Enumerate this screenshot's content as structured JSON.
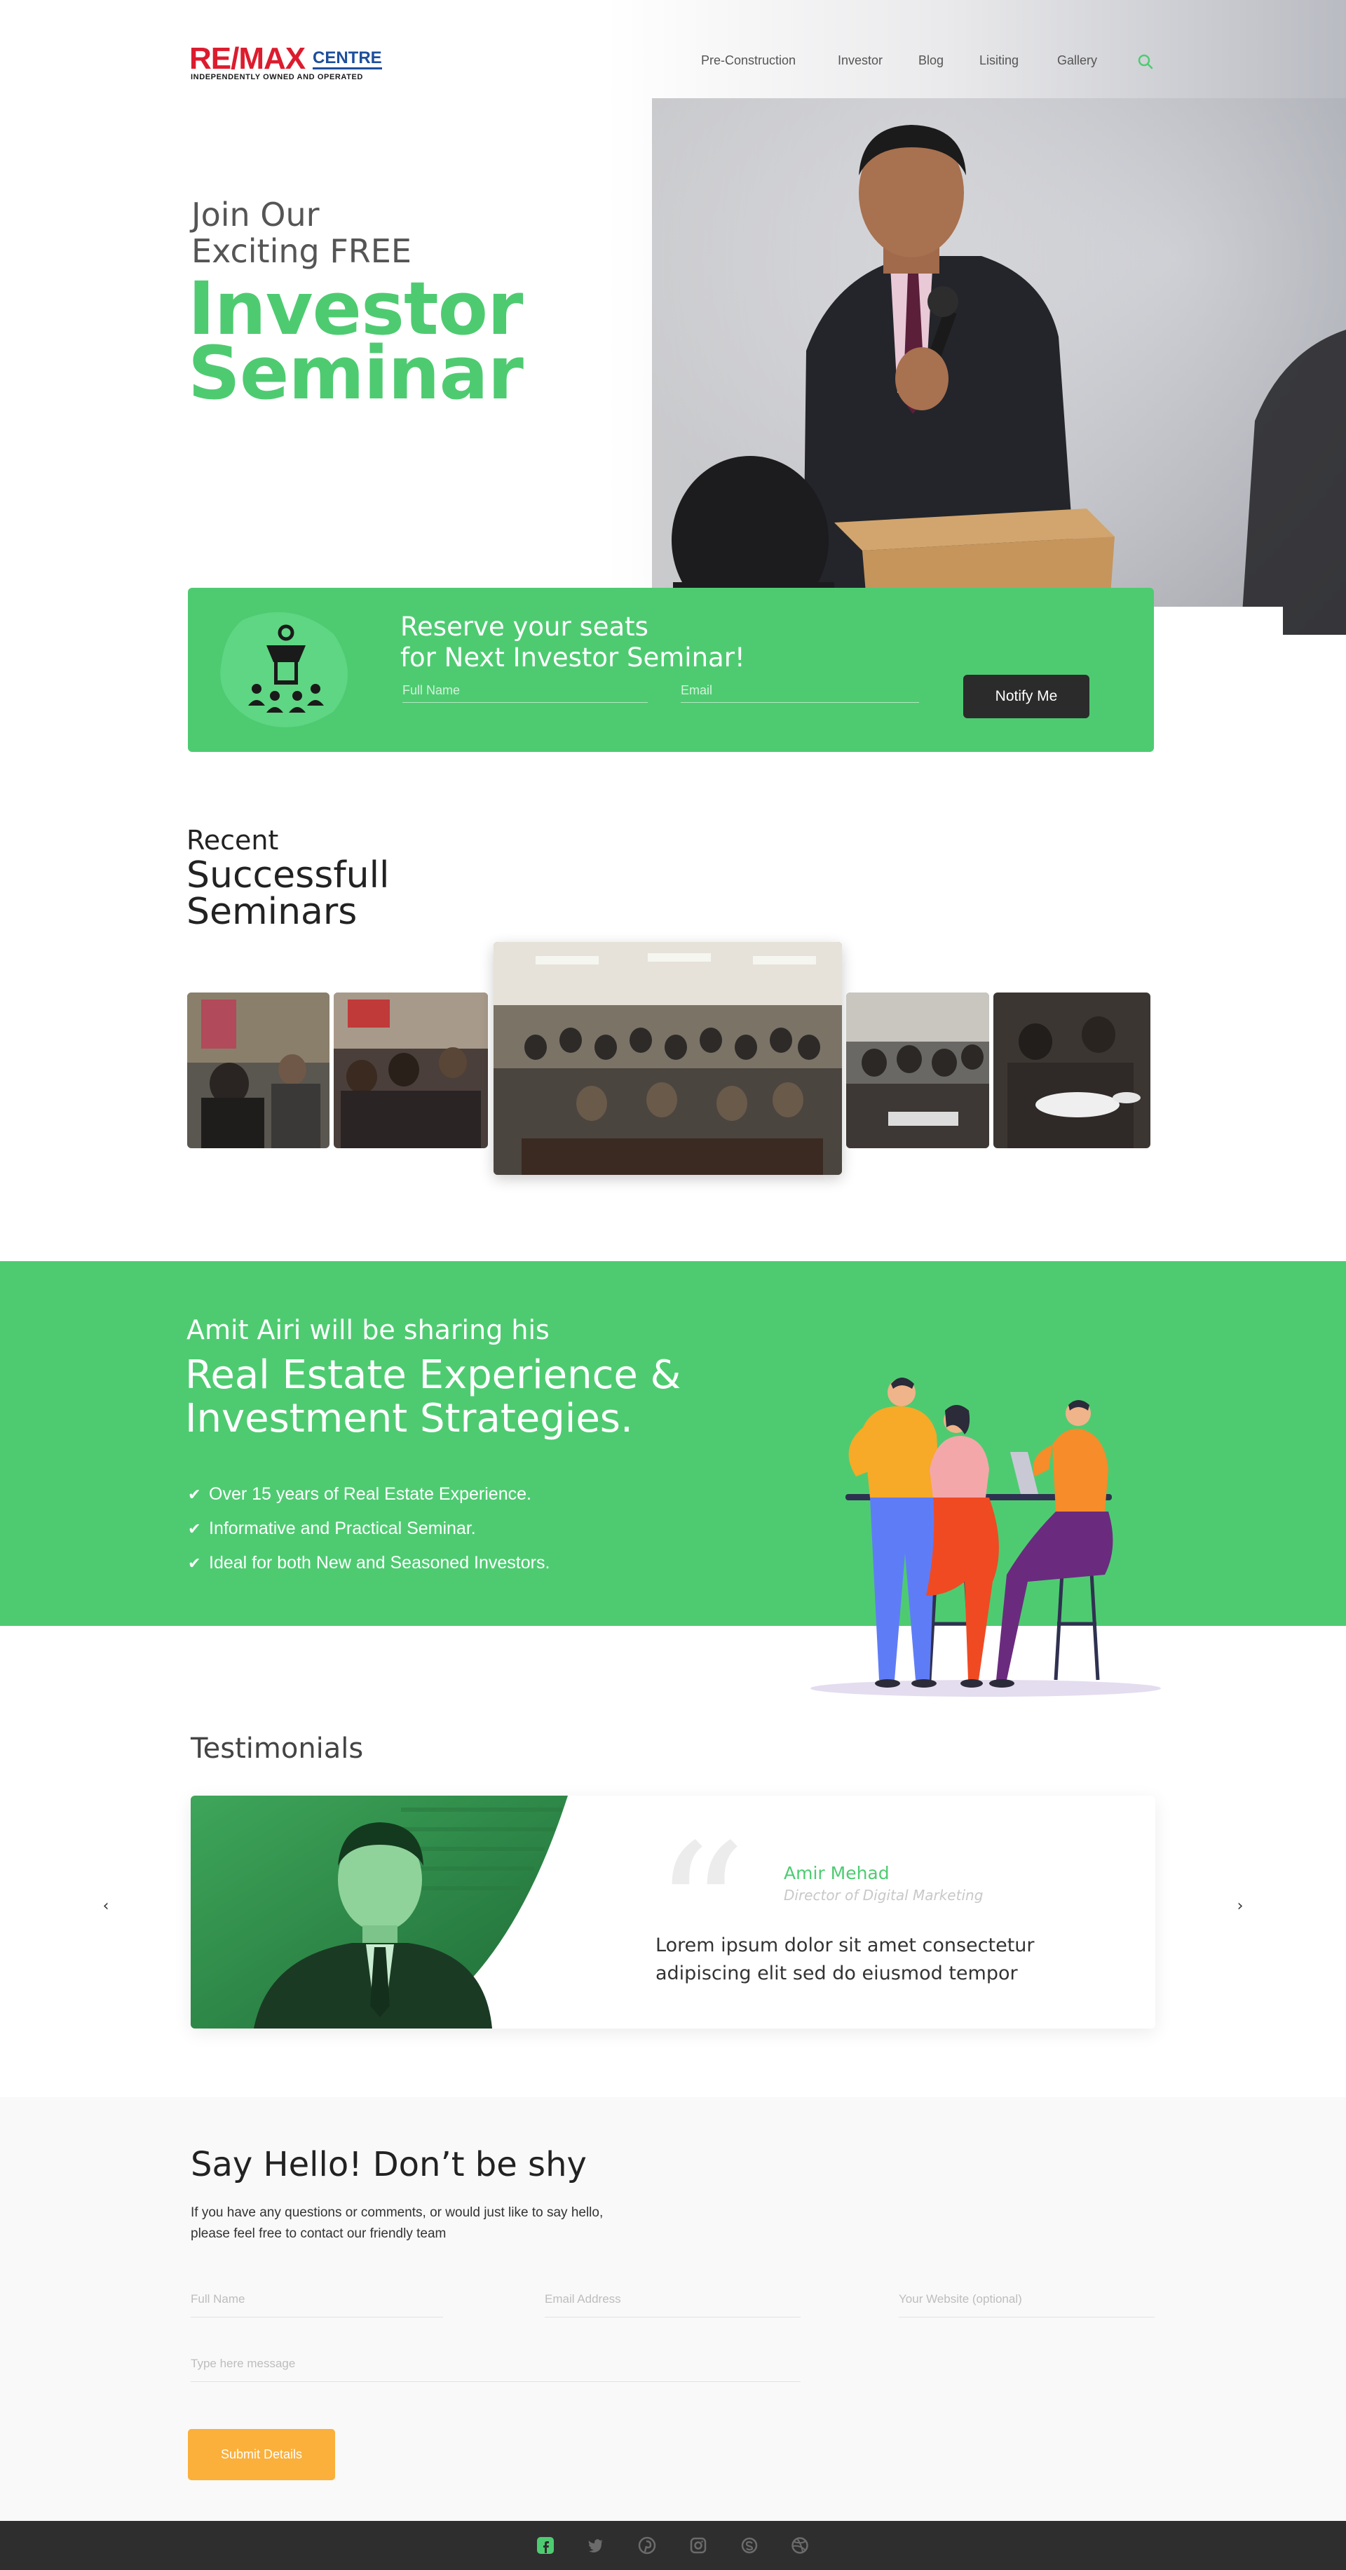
{
  "header": {
    "logo": {
      "brand": "RE/MAX",
      "brand_sub": "CENTRE",
      "tagline": "INDEPENDENTLY OWNED AND OPERATED"
    },
    "nav": [
      "Pre-Construction",
      "Investor",
      "Blog",
      "Lisiting",
      "Gallery"
    ],
    "search_icon": "search-icon"
  },
  "hero": {
    "line1": "Join Our",
    "line2": "Exciting FREE",
    "title1": "Investor",
    "title2": "Seminar"
  },
  "reserve": {
    "title1": "Reserve your seats",
    "title2": "for Next Investor Seminar!",
    "name_placeholder": "Full Name",
    "email_placeholder": "Email",
    "button": "Notify Me",
    "icon": "seminar-icon"
  },
  "recent": {
    "line1": "Recent",
    "line2": "Successfull",
    "line3": "Seminars"
  },
  "band": {
    "subtitle": "Amit Airi will be sharing his",
    "title1": "Real Estate Experience &",
    "title2": "Investment Strategies.",
    "points": [
      "Over 15 years of Real Estate Experience.",
      "Informative and Practical Seminar.",
      "Ideal for both New and Seasoned Investors."
    ]
  },
  "testimonials": {
    "title": "Testimonials",
    "name": "Amir Mehad",
    "role": "Director of Digital Marketing",
    "text1": "Lorem ipsum dolor sit amet consectetur",
    "text2": "adipiscing elit sed do eiusmod tempor",
    "prev": "‹",
    "next": "›"
  },
  "contact": {
    "title": "Say Hello! Don’t be shy",
    "desc1": "If you have any questions or comments, or would just like to say hello,",
    "desc2": "please feel free to contact our friendly team",
    "name_placeholder": "Full Name",
    "email_placeholder": "Email Address",
    "website_placeholder": "Your Website (optional)",
    "message_placeholder": "Type here message",
    "button": "Submit Details"
  },
  "footer": {
    "icons": [
      "facebook-icon",
      "twitter-icon",
      "pinterest-icon",
      "instagram-icon",
      "skype-icon",
      "dribbble-icon"
    ]
  },
  "colors": {
    "accent_green": "#4ecb71",
    "brand_red": "#dc1c2e",
    "brand_blue": "#1d4f9c",
    "submit_orange": "#fbb03b",
    "footer_dark": "#2e2e2e"
  }
}
